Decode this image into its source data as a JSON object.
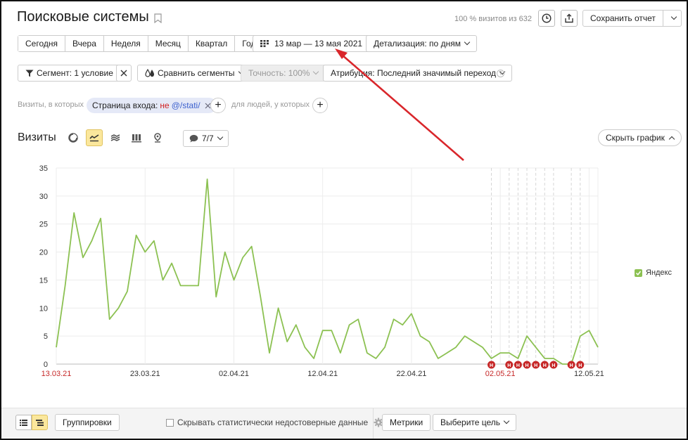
{
  "header": {
    "title": "Поисковые системы",
    "visits_share": "100 % визитов из 632",
    "save_report_label": "Сохранить отчет"
  },
  "period_buttons": [
    "Сегодня",
    "Вчера",
    "Неделя",
    "Месяц",
    "Квартал",
    "Год"
  ],
  "date_range": "13 мар — 13 мая 2021",
  "detail": "Детализация: по дням",
  "segment": "Сегмент: 1 условие",
  "compare_segments": "Сравнить сегменты",
  "accuracy": "Точность: 100%",
  "attribution": "Атрибуция: Последний значимый переход",
  "filter": {
    "visits_label": "Визиты, в которых",
    "chip_label": "Страница входа:",
    "chip_neg": "не",
    "chip_path": "@/stati/",
    "people_label": "для людей, у которых"
  },
  "chart_header": {
    "title": "Визиты",
    "comments_count": "7/7",
    "hide_chart_label": "Скрыть график"
  },
  "bottom": {
    "groupings_label": "Группировки",
    "hide_unreliable_label": "Скрывать статистически недостоверные данные",
    "metrics_label": "Метрики",
    "goal_label": "Выберите цель"
  },
  "colors": {
    "line": "#8cc152",
    "accent_red": "#d32f2f",
    "arrow": "#d9262b",
    "highlight": "#fbe79c"
  },
  "chart_data": {
    "type": "line",
    "title": "",
    "xlabel": "",
    "ylabel": "",
    "ylim": [
      0,
      35
    ],
    "yticks": [
      "0",
      "5",
      "10",
      "15",
      "20",
      "25",
      "30",
      "35"
    ],
    "xtick_labels": [
      {
        "label": "13.03.21",
        "index": 0,
        "red": true
      },
      {
        "label": "23.03.21",
        "index": 10,
        "red": false
      },
      {
        "label": "02.04.21",
        "index": 20,
        "red": false
      },
      {
        "label": "12.04.21",
        "index": 30,
        "red": false
      },
      {
        "label": "22.04.21",
        "index": 40,
        "red": false
      },
      {
        "label": "02.05.21",
        "index": 50,
        "red": true
      },
      {
        "label": "12.05.21",
        "index": 60,
        "red": false
      }
    ],
    "grid": true,
    "legend_position": "right",
    "series": [
      {
        "name": "Яндекс",
        "values": [
          3,
          14,
          27,
          19,
          22,
          26,
          8,
          10,
          13,
          23,
          20,
          22,
          15,
          18,
          14,
          14,
          14,
          33,
          12,
          20,
          15,
          19,
          21,
          12,
          2,
          10,
          4,
          7,
          3,
          1,
          6,
          6,
          2,
          7,
          8,
          2,
          1,
          3,
          8,
          7,
          9,
          5,
          4,
          1,
          2,
          3,
          5,
          4,
          3,
          1,
          2,
          2,
          1,
          5,
          3,
          1,
          1,
          0,
          0,
          5,
          6,
          3
        ]
      }
    ],
    "holiday_marker_label": "H",
    "holiday_indices": [
      49,
      51,
      52,
      53,
      54,
      55,
      56,
      58,
      59
    ]
  }
}
